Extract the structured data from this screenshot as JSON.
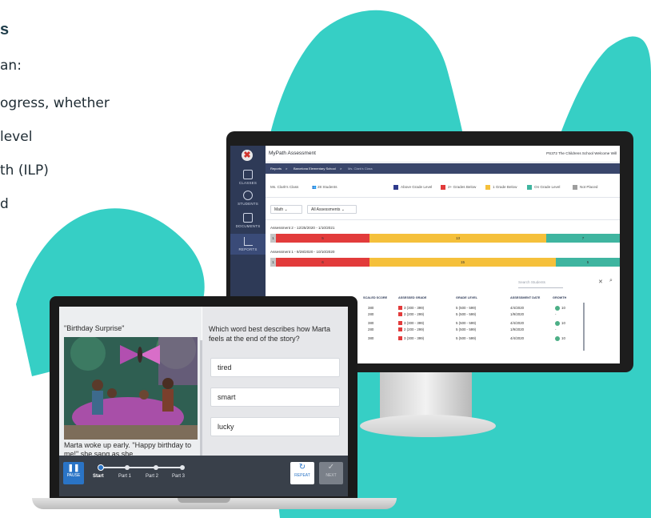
{
  "marketing": {
    "title": "s",
    "intro": "an:",
    "lines": [
      "ogress, whether",
      "level",
      "th (ILP)",
      "d"
    ]
  },
  "monitor": {
    "app_title": "MyPath Assessment",
    "school_user": "PS372 The Childrens School   Welcome Will",
    "breadcrumb": [
      "Reports",
      ">",
      "Barcelona Elementary School",
      ">",
      "Ms. Clark's Class"
    ],
    "sidebar": [
      {
        "label": "CLASSES",
        "icon": "classes-icon"
      },
      {
        "label": "STUDENTS",
        "icon": "students-icon"
      },
      {
        "label": "DOCUMENTS",
        "icon": "documents-icon"
      },
      {
        "label": "REPORTS",
        "icon": "reports-icon",
        "active": true
      }
    ],
    "class_select": "Ms. Clark's Class",
    "student_count": "28 Students",
    "legend": [
      {
        "label": "Above Grade Level",
        "color": "#2e3a8c"
      },
      {
        "label": "2+ Grades Below",
        "color": "#e23b3b"
      },
      {
        "label": "1 Grade Below",
        "color": "#f5c03b"
      },
      {
        "label": "On Grade Level",
        "color": "#3fb5a0"
      },
      {
        "label": "Not Placed",
        "color": "#9e9e9e"
      }
    ],
    "subject": "Math",
    "assessments_filter": "All Assessments",
    "assessments": [
      {
        "label": "Assessment 2 - 12/25/2020 - 1/10/2021",
        "segments": [
          1,
          5,
          13,
          7
        ]
      },
      {
        "label": "Assessment 1 - 9/28/2020 - 10/10/2020",
        "segments": [
          1,
          6,
          15,
          5
        ]
      }
    ],
    "search_placeholder": "Search Students",
    "table_headers": [
      "SCALED SCORE",
      "ASSESSED GRADE",
      "GRADE LEVEL",
      "ASSESSMENT DATE",
      "GROWTH"
    ],
    "table_rows": [
      {
        "score": "380",
        "grade": "3 (300 - 399)",
        "grade_color": "#e23b3b",
        "level": "5 (500 - 599)",
        "date": "4/4/2020",
        "growth": "10"
      },
      {
        "score": "280",
        "grade": "2 (200 - 299)",
        "grade_color": "#e23b3b",
        "level": "5 (500 - 599)",
        "date": "1/9/2020",
        "growth": "-"
      },
      {
        "score": "380",
        "grade": "3 (300 - 399)",
        "grade_color": "#e23b3b",
        "level": "5 (500 - 599)",
        "date": "4/4/2020",
        "growth": "10"
      },
      {
        "score": "280",
        "grade": "2 (200 - 299)",
        "grade_color": "#e23b3b",
        "level": "5 (500 - 599)",
        "date": "1/9/2020",
        "growth": "-"
      },
      {
        "score": "380",
        "grade": "3 (300 - 399)",
        "grade_color": "#e23b3b",
        "level": "5 (500 - 599)",
        "date": "4/4/2020",
        "growth": "10"
      }
    ]
  },
  "laptop": {
    "story_title": "\"Birthday Surprise\"",
    "story_text": "Marta woke up early. \"Happy birthday to me!\" she sang as she",
    "question": "Which word best describes how Marta feels at the end of the story?",
    "answers": [
      "tired",
      "smart",
      "lucky"
    ],
    "pause_label": "PAUSE",
    "steps": [
      "Start",
      "Part 1",
      "Part 2",
      "Part 3"
    ],
    "repeat_label": "REPEAT",
    "next_label": "NEXT"
  },
  "colors": {
    "teal_shape": "#36cfc5",
    "sidebar": "#2e3a57",
    "red": "#e23b3b",
    "yellow": "#f5c03b",
    "green": "#3fb5a0",
    "blue_button": "#2a74c6"
  }
}
